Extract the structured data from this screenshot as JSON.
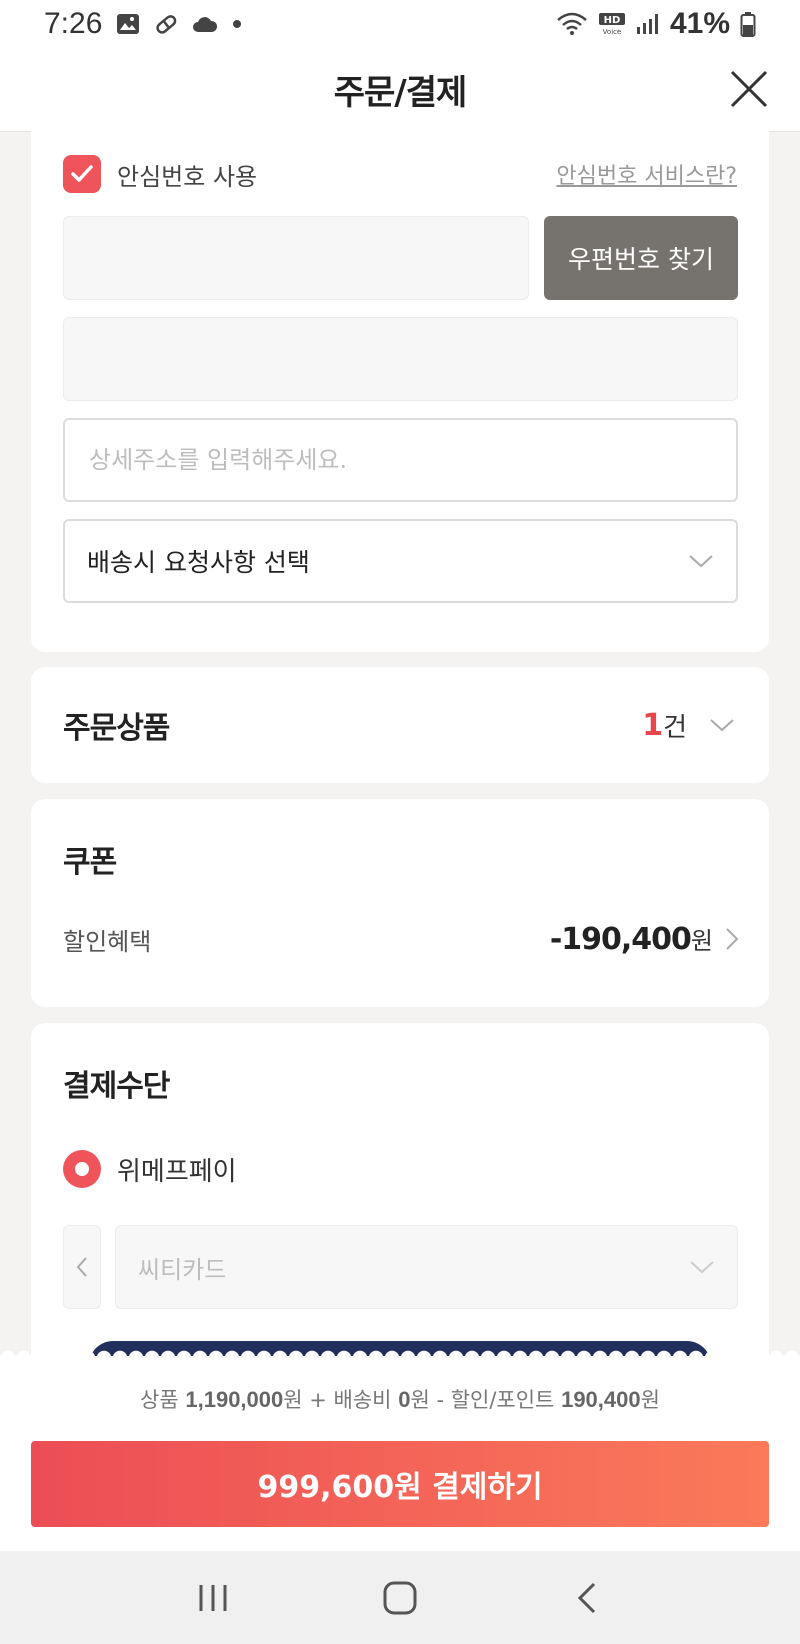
{
  "status_bar": {
    "time": "7:26",
    "battery": "41%",
    "icons": [
      "image-icon",
      "pill-icon",
      "cloud-icon",
      "dot-icon",
      "wifi-icon",
      "hd-voice-icon",
      "signal-icon",
      "battery-icon"
    ]
  },
  "header": {
    "title": "주문/결제",
    "close_icon": "close-icon"
  },
  "address": {
    "safe_number_label": "안심번호 사용",
    "safe_number_checked": true,
    "safe_number_link": "안심번호 서비스란?",
    "zip_button": "우편번호 찾기",
    "zip_value": "",
    "address1_value": "",
    "address2_placeholder": "상세주소를 입력해주세요.",
    "delivery_request": "배송시 요청사항 선택"
  },
  "order": {
    "title": "주문상품",
    "count": "1",
    "count_unit": "건"
  },
  "coupon": {
    "title": "쿠폰",
    "discount_label": "할인혜택",
    "discount_amount": "-190,400",
    "currency": "원"
  },
  "payment": {
    "title": "결제수단",
    "method": "위메프페이",
    "card": "씨티카드"
  },
  "summary": {
    "product_label": "상품",
    "product_amount": "1,190,000",
    "shipping_label": "+ 배송비",
    "shipping_amount": "0",
    "discount_label": "- 할인/포인트",
    "discount_amount": "190,400",
    "won": "원",
    "pay_button": "999,600원 결제하기"
  },
  "colors": {
    "accent": "#f0545b",
    "zip_button_bg": "#76736e",
    "pay_gradient_start": "#ec4d55",
    "pay_gradient_end": "#fb7a5a",
    "card_visual": "#22305e"
  }
}
